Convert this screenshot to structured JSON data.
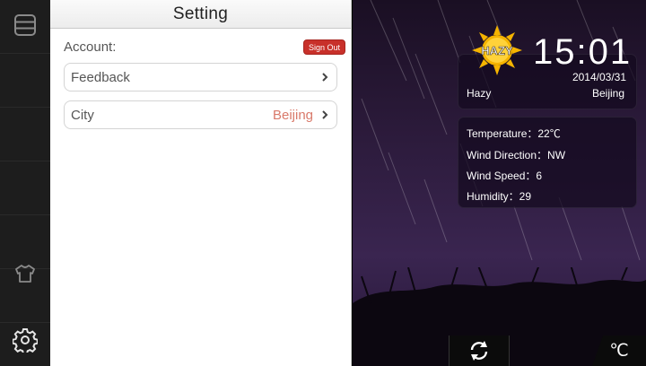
{
  "settings": {
    "title": "Setting",
    "account_label": "Account:",
    "signout_label": "Sign Out",
    "items": [
      {
        "label": "Feedback",
        "value": ""
      },
      {
        "label": "City",
        "value": "Beijing"
      }
    ]
  },
  "weather": {
    "icon_text": "HAZY",
    "time": "15:01",
    "date": "2014/03/31",
    "condition": "Hazy",
    "city": "Beijing",
    "temperature": "Temperature：22℃",
    "wind_direction": "Wind Direction：NW",
    "wind_speed": "Wind Speed：6",
    "humidity": "Humidity：29"
  },
  "controls": {
    "unit_label": "℃"
  },
  "icons": {
    "rail_top": "menu-icon",
    "rail_mid": "shirt-icon",
    "rail_bottom": "gear-icon",
    "refresh": "refresh-icon"
  },
  "colors": {
    "signout": "#c8302a",
    "city_value": "#d9796a"
  }
}
